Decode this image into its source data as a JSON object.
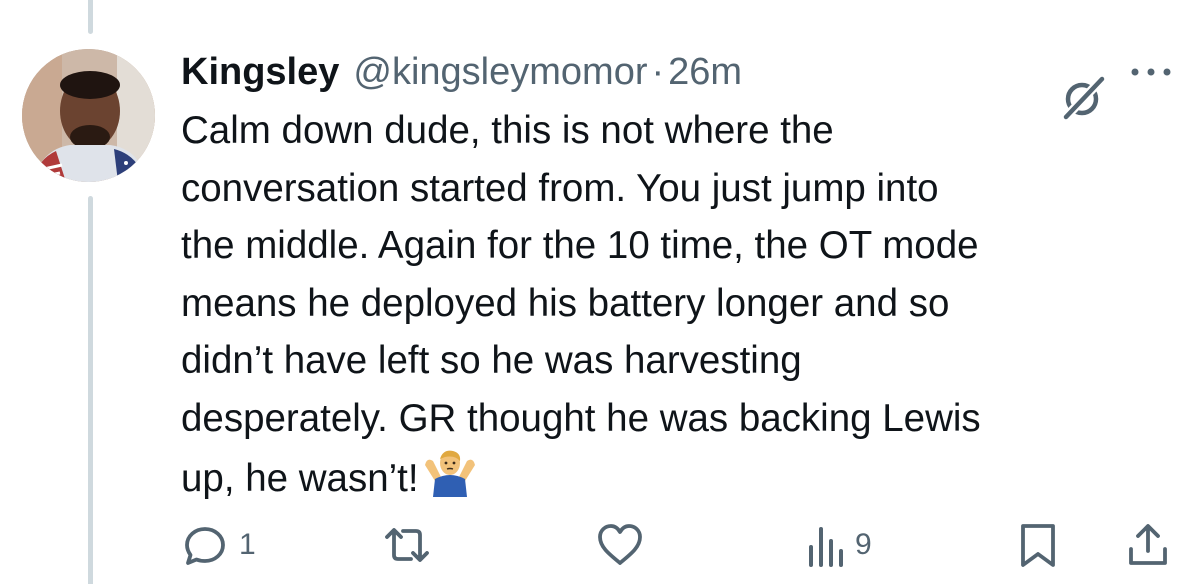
{
  "tweet": {
    "author_name": "Kingsley",
    "author_handle": "@kingsleymomor",
    "separator": "·",
    "timestamp": "26m",
    "text_lines": [
      "Calm down dude, this is not where the",
      "conversation started from. You just jump into",
      "the middle. Again for the 10 time, the OT mode",
      "means he deployed his battery longer and so",
      "didn’t have left so he was harvesting",
      "desperately. GR thought he was backing Lewis",
      "up, he wasn’t!"
    ],
    "emoji": "man-shrugging"
  },
  "actions": {
    "reply_count": "1",
    "retweet_count": "",
    "like_count": "",
    "views_count": "9"
  },
  "colors": {
    "text": "#0f1419",
    "secondary": "#536471",
    "thread_line": "#cfd9de"
  },
  "icons": [
    "grok-icon",
    "more-icon",
    "reply-icon",
    "retweet-icon",
    "like-icon",
    "views-icon",
    "bookmark-icon",
    "share-icon"
  ]
}
